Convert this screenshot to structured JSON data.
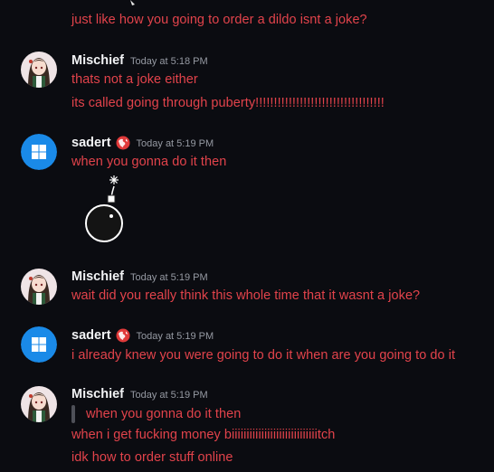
{
  "theme": {
    "background": "#0b0c11",
    "message_color": "#e2434b",
    "username_color": "#f2f3f5",
    "timestamp_color": "#969aa3",
    "windows_blue": "#1a8ae8",
    "globe_red": "#e03a3a"
  },
  "messages": [
    {
      "lines": [
        "just like how you going to order a dildo isnt a joke?"
      ]
    },
    {
      "author": "Mischief",
      "timestamp": "Today at 5:18 PM",
      "avatar": "anime-girl-avatar",
      "lines": [
        "thats not a joke either",
        "its called going through puberty!!!!!!!!!!!!!!!!!!!!!!!!!!!!!!!!!!!"
      ]
    },
    {
      "author": "sadert",
      "timestamp": "Today at 5:19 PM",
      "avatar": "windows-logo-avatar",
      "badge": "globe-icon",
      "lines": [
        "when you gonna do it then"
      ],
      "attachment": "bomb-sticker"
    },
    {
      "author": "Mischief",
      "timestamp": "Today at 5:19 PM",
      "avatar": "anime-girl-avatar",
      "lines": [
        "wait did you really think this whole time that it wasnt a joke?"
      ]
    },
    {
      "author": "sadert",
      "timestamp": "Today at 5:19 PM",
      "avatar": "windows-logo-avatar",
      "badge": "globe-icon",
      "lines": [
        "i already knew you were going to do it when are you going to do it"
      ]
    },
    {
      "author": "Mischief",
      "timestamp": "Today at 5:19 PM",
      "avatar": "anime-girl-avatar",
      "quote": "when you gonna do it then",
      "lines": [
        "when i get fucking money biiiiiiiiiiiiiiiiiiiiiiiiiiiiitch",
        "idk how to order stuff online"
      ]
    }
  ]
}
